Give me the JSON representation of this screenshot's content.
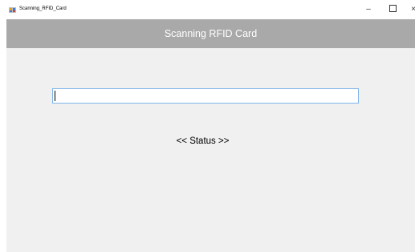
{
  "window": {
    "title": "Scanning_RFID_Card",
    "minimize_glyph": "–",
    "close_glyph": "×",
    "app_icon": "rfid-app-icon"
  },
  "form": {
    "header_title": "Scanning RFID Card",
    "header_color": "#a9a9a9",
    "background_color": "#f0f0f0",
    "card_input_value": "",
    "status_label": "<< Status >>"
  }
}
